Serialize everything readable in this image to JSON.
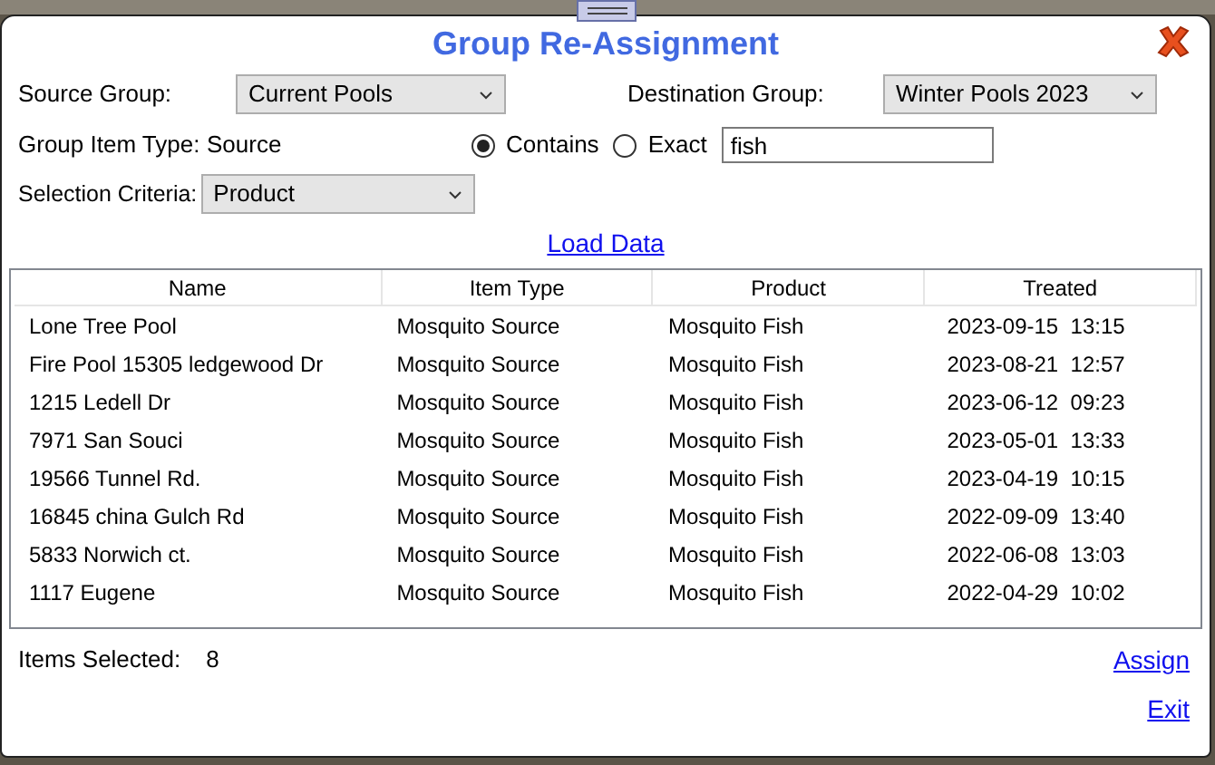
{
  "dialog": {
    "title": "Group Re-Assignment"
  },
  "source_group": {
    "label": "Source Group:",
    "value": "Current Pools"
  },
  "destination_group": {
    "label": "Destination Group:",
    "value": "Winter Pools 2023"
  },
  "group_item_type": {
    "label": "Group Item Type:",
    "value": "Source"
  },
  "match_modes": [
    {
      "label": "Contains",
      "selected": true
    },
    {
      "label": "Exact",
      "selected": false
    }
  ],
  "search": {
    "value": "fish"
  },
  "selection_criteria": {
    "label": "Selection Criteria:",
    "value": "Product"
  },
  "load_link": "Load Data",
  "table": {
    "columns": [
      "Name",
      "Item Type",
      "Product",
      "Treated"
    ],
    "rows": [
      [
        "Lone Tree Pool",
        "Mosquito Source",
        "Mosquito Fish",
        "2023-09-15  13:15"
      ],
      [
        "Fire Pool 15305 ledgewood Dr",
        "Mosquito Source",
        "Mosquito Fish",
        "2023-08-21  12:57"
      ],
      [
        "1215 Ledell Dr",
        "Mosquito Source",
        "Mosquito Fish",
        "2023-06-12  09:23"
      ],
      [
        "7971 San Souci",
        "Mosquito Source",
        "Mosquito Fish",
        "2023-05-01  13:33"
      ],
      [
        "19566 Tunnel Rd.",
        "Mosquito Source",
        "Mosquito Fish",
        "2023-04-19  10:15"
      ],
      [
        "16845 china Gulch Rd",
        "Mosquito Source",
        "Mosquito Fish",
        "2022-09-09  13:40"
      ],
      [
        "5833 Norwich ct.",
        "Mosquito Source",
        "Mosquito Fish",
        "2022-06-08  13:03"
      ],
      [
        "1117 Eugene",
        "Mosquito Source",
        "Mosquito Fish",
        "2022-04-29  10:02"
      ]
    ]
  },
  "items_selected": {
    "label": "Items Selected:",
    "value": "8"
  },
  "assign_link": "Assign",
  "exit_link": "Exit"
}
